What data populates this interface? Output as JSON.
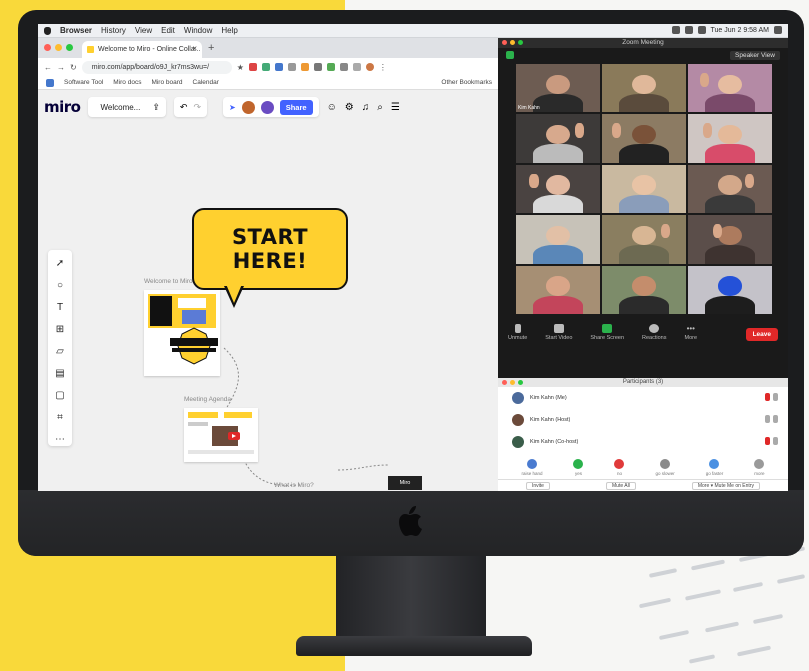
{
  "colors": {
    "backdrop_yellow": "#f9d93a",
    "miro_yellow": "#ffd02f",
    "share_blue": "#4262ff",
    "zoom_red": "#e02828",
    "zoom_green": "#2bb24c"
  },
  "menubar": {
    "app": "Browser",
    "items": [
      "Browser",
      "History",
      "View",
      "Edit",
      "Window",
      "Help"
    ],
    "clock": "Tue Jun 2 9:58 AM"
  },
  "browser": {
    "tab_title": "Welcome to Miro - Online Colla...",
    "url": "miro.com/app/board/o9J_kr7ms3wu=/",
    "bookmarks": [
      "Software Tool",
      "Miro docs",
      "Miro board",
      "Calendar",
      "Other Bookmarks"
    ]
  },
  "miro": {
    "logo": "miro",
    "board_title": "Welcome...",
    "share_label": "Share",
    "toolbar_icons": [
      "cursor-icon",
      "shape-icon",
      "text-icon",
      "table-icon",
      "sticky-note-icon",
      "template-icon",
      "frame-icon",
      "crop-icon",
      "more-icon"
    ],
    "callout": {
      "line1": "START",
      "line2": "HERE!"
    },
    "frames": [
      "Welcome to Miro",
      "Meeting Agenda",
      "What is Miro?"
    ],
    "dark_card": "Miro"
  },
  "zoom": {
    "window_title": "Zoom Meeting",
    "view_label": "Speaker View",
    "controls": [
      {
        "label": "Unmute",
        "icon": "microphone-icon"
      },
      {
        "label": "Start Video",
        "icon": "video-icon"
      },
      {
        "label": "Share Screen",
        "icon": "share-screen-icon"
      },
      {
        "label": "Reactions",
        "icon": "reactions-icon"
      },
      {
        "label": "More",
        "icon": "more-icon"
      }
    ],
    "leave_label": "Leave",
    "tile_name": "Kim Kahn"
  },
  "participants": {
    "title": "Participants (3)",
    "rows": [
      {
        "name": "Kim Kahn (Me)",
        "avatar": "#4b6a9b"
      },
      {
        "name": "Kim Kahn (Host)",
        "avatar": "#6b4a3a"
      },
      {
        "name": "Kim Kahn (Co-host)",
        "avatar": "#3a5d4a"
      }
    ],
    "reactions": [
      {
        "label": "raise hand",
        "color": "#4a7bd0"
      },
      {
        "label": "yes",
        "color": "#2bb24c"
      },
      {
        "label": "no",
        "color": "#e03a3a"
      },
      {
        "label": "go slower",
        "color": "#8a8a8a"
      },
      {
        "label": "go faster",
        "color": "#4a90e2"
      },
      {
        "label": "more",
        "color": "#9a9a9a"
      }
    ],
    "buttons": [
      "Invite",
      "Mute All",
      "More ▾ Mute Me on Entry"
    ]
  }
}
